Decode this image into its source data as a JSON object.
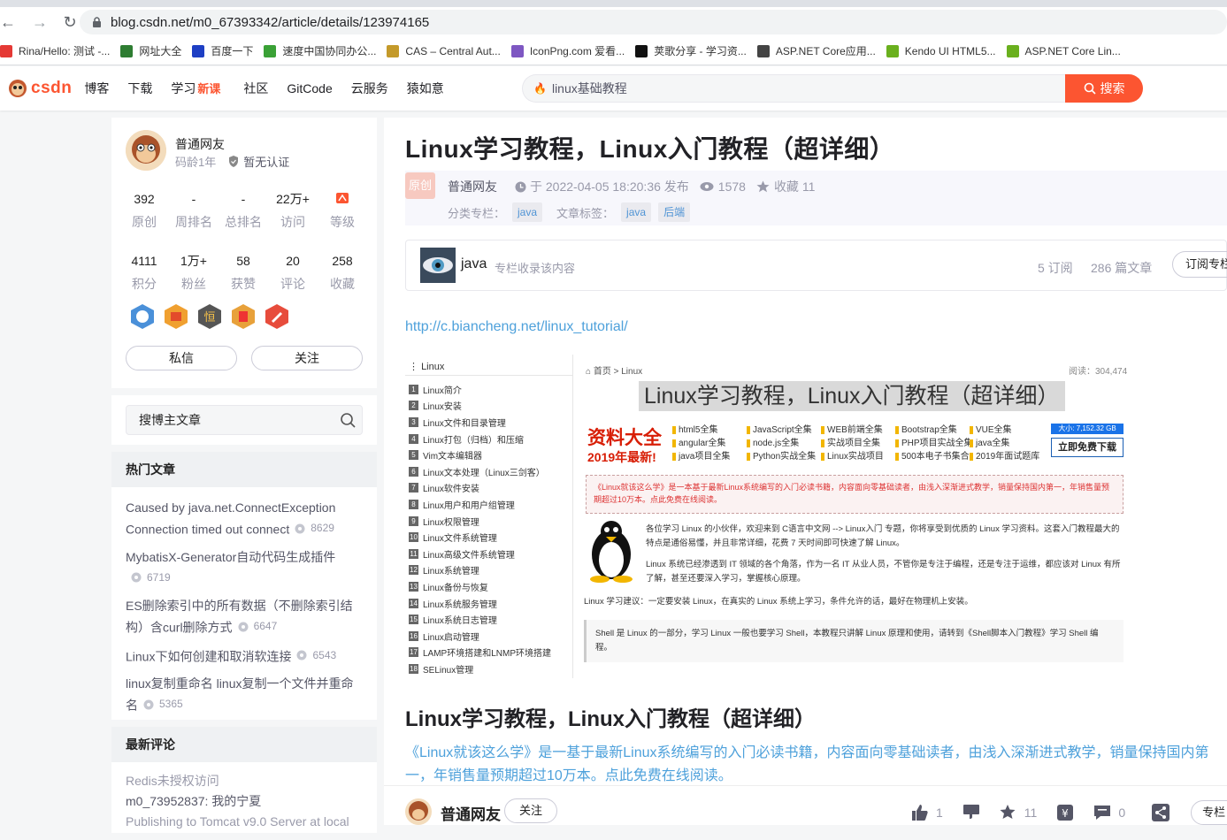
{
  "browser": {
    "url": "blog.csdn.net/m0_67393342/article/details/123974165",
    "bookmarks": [
      {
        "label": "Rina/Hello: 测试 -...",
        "color": "#e53935"
      },
      {
        "label": "网址大全",
        "color": "#2e7d32"
      },
      {
        "label": "百度一下",
        "color": "#1e3fc4"
      },
      {
        "label": "速度中国协同办公...",
        "color": "#3aa136"
      },
      {
        "label": "CAS – Central Aut...",
        "color": "#c49a2a"
      },
      {
        "label": "IconPng.com 爱看...",
        "color": "#7e57c2"
      },
      {
        "label": "荚歌分享 - 学习资...",
        "color": "#111111"
      },
      {
        "label": "ASP.NET Core应用...",
        "color": "#444444"
      },
      {
        "label": "Kendo UI HTML5...",
        "color": "#6ab01e"
      },
      {
        "label": "ASP.NET Core Lin...",
        "color": "#6ab01e"
      }
    ]
  },
  "csdn": {
    "logo": "CSDN",
    "nav": [
      "博客",
      "下载",
      "学习",
      "社区",
      "GitCode",
      "云服务",
      "猿如意"
    ],
    "nav_badge": "新课",
    "search_placeholder": "linux基础教程",
    "search_button": "搜索"
  },
  "profile": {
    "name": "普通网友",
    "age": "码龄1年",
    "cert": "暂无认证",
    "stats1": [
      {
        "value": "392",
        "label": "原创"
      },
      {
        "value": "-",
        "label": "周排名"
      },
      {
        "value": "-",
        "label": "总排名"
      },
      {
        "value": "22万+",
        "label": "访问"
      },
      {
        "value": "",
        "label": "等级"
      }
    ],
    "stats2": [
      {
        "value": "4111",
        "label": "积分"
      },
      {
        "value": "1万+",
        "label": "粉丝"
      },
      {
        "value": "58",
        "label": "获赞"
      },
      {
        "value": "20",
        "label": "评论"
      },
      {
        "value": "258",
        "label": "收藏"
      }
    ],
    "btn_message": "私信",
    "btn_follow": "关注"
  },
  "sidebar": {
    "search_placeholder": "搜博主文章",
    "hot_title": "热门文章",
    "hot": [
      {
        "title": "Caused by java.net.ConnectException Connection timed out connect",
        "views": "8629"
      },
      {
        "title": "MybatisX-Generator自动代码生成插件",
        "views": "6719"
      },
      {
        "title": "ES删除索引中的所有数据（不删除索引结构）含curl删除方式",
        "views": "6647"
      },
      {
        "title": "Linux下如何创建和取消软连接",
        "views": "6543"
      },
      {
        "title": "linux复制重命名 linux复制一个文件并重命名",
        "views": "5365"
      }
    ],
    "comments_title": "最新评论",
    "comments": [
      {
        "title": "Redis未授权访问",
        "text": "m0_73952837: 我的宁夏"
      },
      {
        "title": "Publishing to Tomcat v9.0 Server at local",
        "text": ""
      }
    ]
  },
  "article": {
    "title": "Linux学习教程，Linux入门教程（超详细）",
    "badge": "原创",
    "author": "普通网友",
    "date": "于 2022-04-05 18:20:36 发布",
    "views": "1578",
    "collect": "收藏 11",
    "column_label": "分类专栏：",
    "column_tag": "java",
    "tags_label": "文章标签：",
    "tags": [
      "java",
      "后端"
    ],
    "column_card": {
      "name": "java",
      "desc": "专栏收录该内容",
      "subs": "5 订阅",
      "count": "286 篇文章",
      "btn": "订阅专栏"
    },
    "link": "http://c.biancheng.net/linux_tutorial/",
    "section_title": "Linux学习教程，Linux入门教程（超详细）",
    "intro": "《Linux就该这么学》是一基于最新Linux系统编写的入门必读书籍，内容面向零基础读者，由浅入深渐进式教学，销量保持国内第一，年销售量预期超过10万本。点此免费在线阅读。"
  },
  "screenshot": {
    "toc_title": "Linux",
    "toc": [
      "Linux简介",
      "Linux安装",
      "Linux文件和目录管理",
      "Linux打包（归档）和压缩",
      "Vim文本编辑器",
      "Linux文本处理（Linux三剑客）",
      "Linux软件安装",
      "Linux用户和用户组管理",
      "Linux权限管理",
      "Linux文件系统管理",
      "Linux高级文件系统管理",
      "Linux系统管理",
      "Linux备份与恢复",
      "Linux系统服务管理",
      "Linux系统日志管理",
      "Linux启动管理",
      "LAMP环境搭建和LNMP环境搭建",
      "SELinux管理"
    ],
    "breadcrumb": "首页 > Linux",
    "reads": "阅读：304,474",
    "title": "Linux学习教程，Linux入门教程（超详细）",
    "ad_big": "资料大全",
    "ad_year": "2019年最新!",
    "ad_items": [
      "html5全集",
      "JavaScript全集",
      "WEB前端全集",
      "Bootstrap全集",
      "VUE全集",
      "angular全集",
      "node.js全集",
      "实战项目全集",
      "PHP项目实战全集",
      "java全集",
      "java项目全集",
      "Python实战全集",
      "Linux实战项目",
      "500本电子书集合",
      "2019年面试题库"
    ],
    "ad_size": "大小: 7,152.32 GB",
    "ad_btn": "立即免费下载",
    "notice": "《Linux就该这么学》是一本基于最新Linux系统编写的入门必读书籍，内容面向零基础读者，由浅入深渐进式教学，销量保持国内第一，年销售量预期超过10万本。点此免费在线阅读。",
    "p1": "各位学习 Linux 的小伙伴，欢迎来到 C语言中文网 --> Linux入门 专题，你将享受到优质的 Linux 学习资料。这套入门教程最大的特点是通俗易懂，并且非常详细，花费 7 天时间即可快速了解 Linux。",
    "p2": "Linux 系统已经渗透到 IT 领域的各个角落，作为一名 IT 从业人员，不管你是专注于编程，还是专注于运维，都应该对 Linux 有所了解，甚至还要深入学习，掌握核心原理。",
    "p3": "Linux 学习建议：一定要安装 Linux，在真实的 Linux 系统上学习，条件允许的话，最好在物理机上安装。",
    "p4": "Shell 是 Linux 的一部分，学习 Linux 一般也要学习 Shell，本教程只讲解 Linux 原理和使用，请转到《Shell脚本入门教程》学习 Shell 编程。"
  },
  "bottom": {
    "author": "普通网友",
    "follow": "关注",
    "likes": "1",
    "collect": "11",
    "comments": "0",
    "column_btn": "专栏目"
  }
}
